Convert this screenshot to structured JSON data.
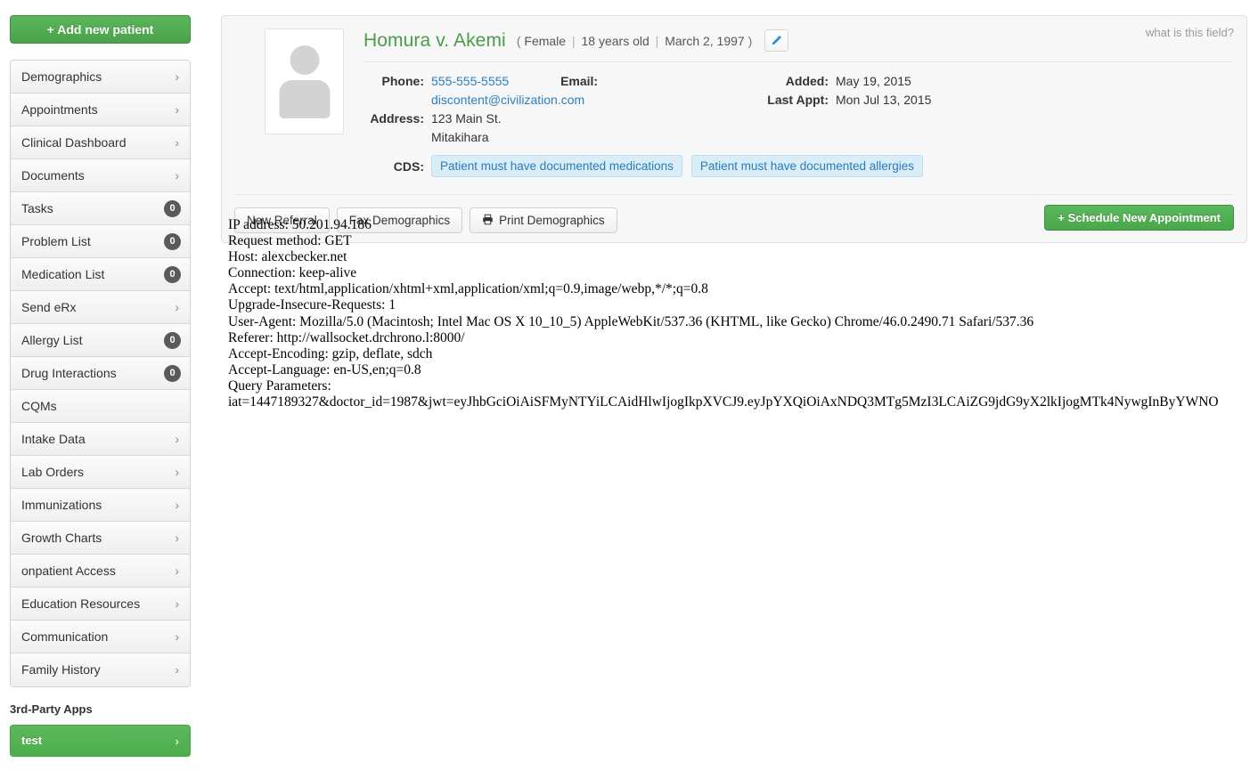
{
  "sidebar": {
    "add_patient_label": "+ Add new patient",
    "items": [
      {
        "label": "Demographics",
        "type": "chevron",
        "chevron": "›"
      },
      {
        "label": "Appointments",
        "type": "chevron",
        "chevron": "›"
      },
      {
        "label": "Clinical Dashboard",
        "type": "chevron",
        "chevron": "›"
      },
      {
        "label": "Documents",
        "type": "chevron",
        "chevron": "›"
      },
      {
        "label": "Tasks",
        "type": "badge",
        "badge": "0"
      },
      {
        "label": "Problem List",
        "type": "badge",
        "badge": "0"
      },
      {
        "label": "Medication List",
        "type": "badge",
        "badge": "0"
      },
      {
        "label": "Send eRx",
        "type": "chevron",
        "chevron": "›"
      },
      {
        "label": "Allergy List",
        "type": "badge",
        "badge": "0"
      },
      {
        "label": "Drug Interactions",
        "type": "badge",
        "badge": "0"
      },
      {
        "label": "CQMs",
        "type": "none"
      },
      {
        "label": "Intake Data",
        "type": "chevron",
        "chevron": "›"
      },
      {
        "label": "Lab Orders",
        "type": "chevron",
        "chevron": "›"
      },
      {
        "label": "Immunizations",
        "type": "chevron",
        "chevron": "›"
      },
      {
        "label": "Growth Charts",
        "type": "chevron",
        "chevron": "›"
      },
      {
        "label": "onpatient Access",
        "type": "chevron",
        "chevron": "›"
      },
      {
        "label": "Education Resources",
        "type": "chevron",
        "chevron": "›"
      },
      {
        "label": "Communication",
        "type": "chevron",
        "chevron": "›"
      },
      {
        "label": "Family History",
        "type": "chevron",
        "chevron": "›"
      }
    ],
    "third_party_title": "3rd-Party Apps",
    "app_label": "test",
    "app_chevron": "›"
  },
  "patient": {
    "what_is_this_field": "what is this field?",
    "name": "Homura v. Akemi",
    "paren_open": "(",
    "gender": "Female",
    "age": "18 years old",
    "dob": "March 2, 1997",
    "paren_close": ")",
    "separator": "|",
    "avatar_icon": "person-placeholder-icon",
    "edit_icon": "pencil-icon",
    "phone_label": "Phone:",
    "phone_value": "555-555-5555",
    "email_label": "Email:",
    "email_value": "discontent@civilization.com",
    "address_label": "Address:",
    "address_line1": "123 Main St.",
    "address_line2": "Mitakihara",
    "added_label": "Added:",
    "added_value": "May 19, 2015",
    "last_appt_label": "Last Appt:",
    "last_appt_value": "Mon Jul 13, 2015",
    "cds_label": "CDS:",
    "cds_badges": [
      "Patient must have documented medications",
      "Patient must have documented allergies"
    ]
  },
  "toolbar": {
    "new_referral": "New Referral",
    "fax_demographics": "Fax Demographics",
    "print_icon": "printer-icon",
    "print_demographics": "Print Demographics",
    "schedule_appointment": "+ Schedule New Appointment"
  },
  "content": {
    "lines": [
      "IP address: 50.201.94.186",
      "Request method: GET",
      "Host: alexcbecker.net",
      "Connection: keep-alive",
      "Accept: text/html,application/xhtml+xml,application/xml;q=0.9,image/webp,*/*;q=0.8",
      "Upgrade-Insecure-Requests: 1",
      "User-Agent: Mozilla/5.0 (Macintosh; Intel Mac OS X 10_10_5) AppleWebKit/537.36 (KHTML, like Gecko) Chrome/46.0.2490.71 Safari/537.36",
      "Referer: http://wallsocket.drchrono.l:8000/",
      "Accept-Encoding: gzip, deflate, sdch",
      "Accept-Language: en-US,en;q=0.8",
      "Query Parameters:",
      "iat=1447189327&doctor_id=1987&jwt=eyJhbGciOiAiSFMyNTYiLCAidHlwIjogIkpXVCJ9.eyJpYXQiOiAxNDQ3MTg5MzI3LCAiZG9jdG9yX2lkIjogMTk4NywgInByYWNO"
    ]
  },
  "colors": {
    "brand_green": "#51a351",
    "name_green": "#4a9b4a",
    "link_blue": "#2a7fc1",
    "badge_blue_bg": "#d9edf7",
    "badge_blue_text": "#2b7bb9"
  }
}
